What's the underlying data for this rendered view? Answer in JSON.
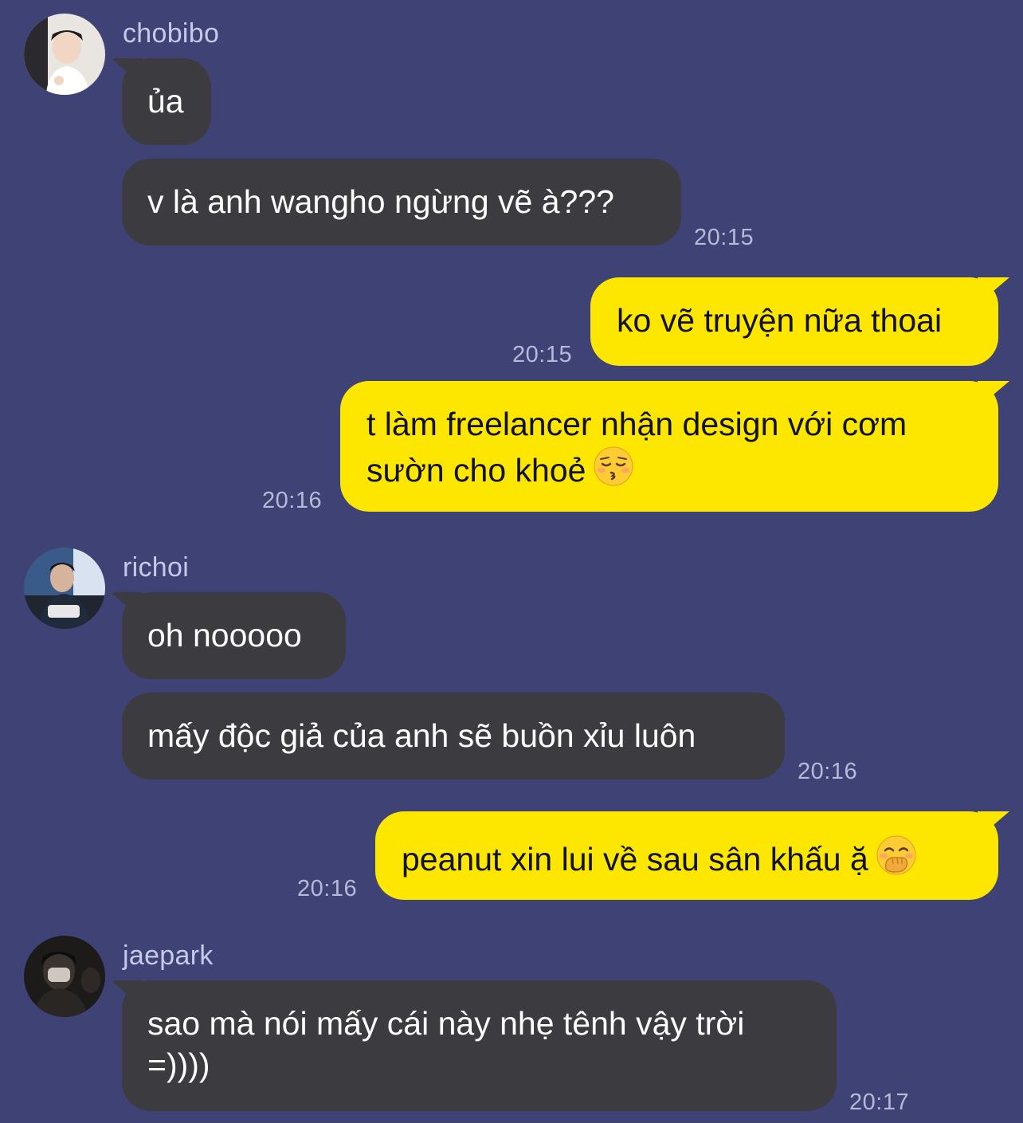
{
  "theme": {
    "background": "#3f4275",
    "incoming_bubble": "#3b3b40",
    "outgoing_bubble": "#fde600",
    "sender_text": "#c7c9e8",
    "time_text": "#b7b9d8"
  },
  "messages": [
    {
      "sender": "chobibo",
      "text": "ủa"
    },
    {
      "text": "v là anh wangho ngừng vẽ à???",
      "time": "20:15"
    },
    {
      "text": "ko vẽ truyện nữa thoai",
      "time": "20:15"
    },
    {
      "line1": "t làm freelancer nhận design với cơm",
      "line2": "sườn cho khoẻ",
      "emoji": "kissing-face-closed-eyes",
      "time": "20:16"
    },
    {
      "sender": "richoi",
      "text": "oh nooooo"
    },
    {
      "text": "mấy độc giả của anh sẽ buồn xỉu luôn",
      "time": "20:16"
    },
    {
      "text": "peanut xin lui về sau sân khấu ặ",
      "emoji": "face-with-hand-over-mouth",
      "time": "20:16"
    },
    {
      "sender": "jaepark",
      "line1": "sao mà nói mấy cái này nhẹ tênh vậy trời",
      "line2": "=))))",
      "time": "20:17"
    }
  ]
}
